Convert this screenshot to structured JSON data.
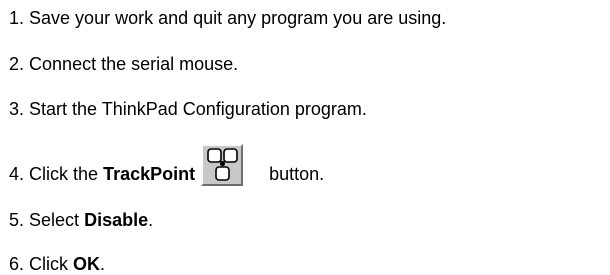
{
  "steps": [
    {
      "num": "1.",
      "text": "Save your work and quit any program you are using."
    },
    {
      "num": "2.",
      "text": "Connect the serial mouse."
    },
    {
      "num": "3.",
      "text": "Start the ThinkPad Configuration program."
    },
    {
      "num": "4.",
      "pre": "Click the",
      "bold": "TrackPoint",
      "post": "button.",
      "icon": "trackpoint-icon"
    },
    {
      "num": "5.",
      "pre": "Select",
      "bold": "Disable",
      "post": "."
    },
    {
      "num": "6.",
      "pre": "Click",
      "bold": "OK",
      "post": "."
    }
  ]
}
